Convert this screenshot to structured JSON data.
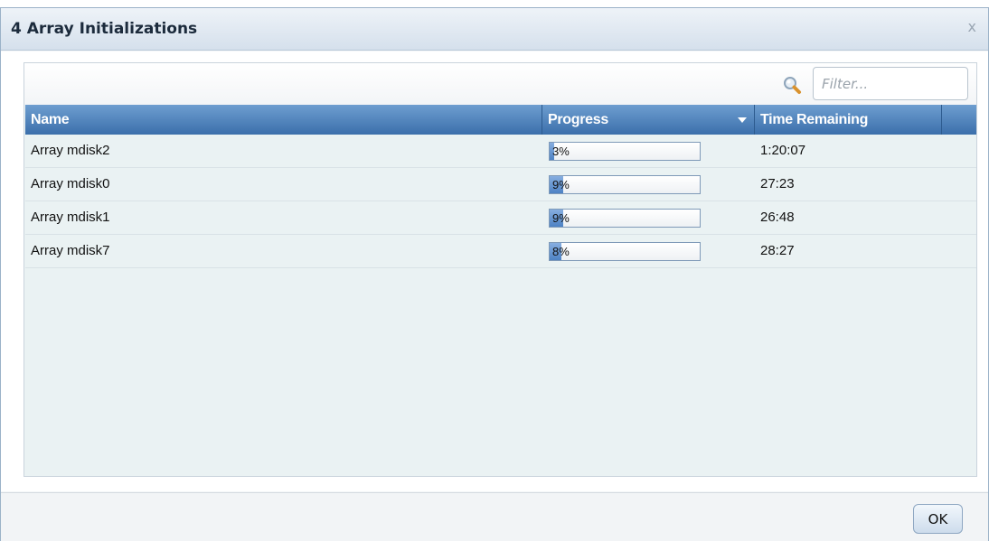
{
  "dialog": {
    "title": "4 Array Initializations",
    "close_label": "x"
  },
  "filter": {
    "placeholder": "Filter...",
    "icon": "search-icon"
  },
  "table": {
    "columns": [
      "Name",
      "Progress",
      "Time Remaining",
      ""
    ],
    "sort_column": "Progress",
    "rows": [
      {
        "name": "Array mdisk2",
        "progress_label": "3%",
        "progress_fraction": 0.03,
        "time_remaining": "1:20:07"
      },
      {
        "name": "Array mdisk0",
        "progress_label": "9%",
        "progress_fraction": 0.09,
        "time_remaining": "27:23"
      },
      {
        "name": "Array mdisk1",
        "progress_label": "9%",
        "progress_fraction": 0.09,
        "time_remaining": "26:48"
      },
      {
        "name": "Array mdisk7",
        "progress_label": "8%",
        "progress_fraction": 0.08,
        "time_remaining": "28:27"
      }
    ]
  },
  "footer": {
    "ok_label": "OK"
  },
  "colors": {
    "header_blue": "#3b6fab",
    "row_bg": "#eaf2f3",
    "progress_fill": "#4d82c4"
  }
}
